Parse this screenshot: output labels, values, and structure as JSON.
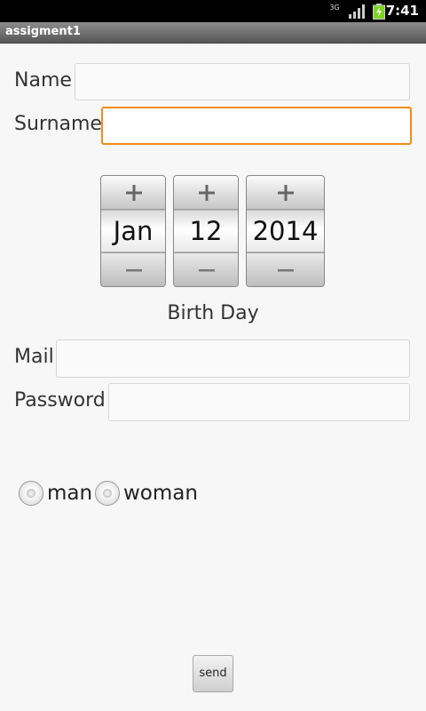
{
  "status_bar": {
    "network": "3G",
    "time": "7:41"
  },
  "app": {
    "title": "assigment1"
  },
  "form": {
    "name_label": "Name",
    "name_value": "",
    "surname_label": "Surname",
    "surname_value": "",
    "birth_date": {
      "month": "Jan",
      "day": "12",
      "year": "2014"
    },
    "birth_label": "Birth Day",
    "mail_label": "Mail",
    "mail_value": "",
    "password_label": "Password",
    "password_value": "",
    "gender_options": [
      "man",
      "woman"
    ],
    "send_label": "send"
  },
  "colors": {
    "focus_accent": "#f08c1c",
    "battery_green": "#7ed321"
  }
}
